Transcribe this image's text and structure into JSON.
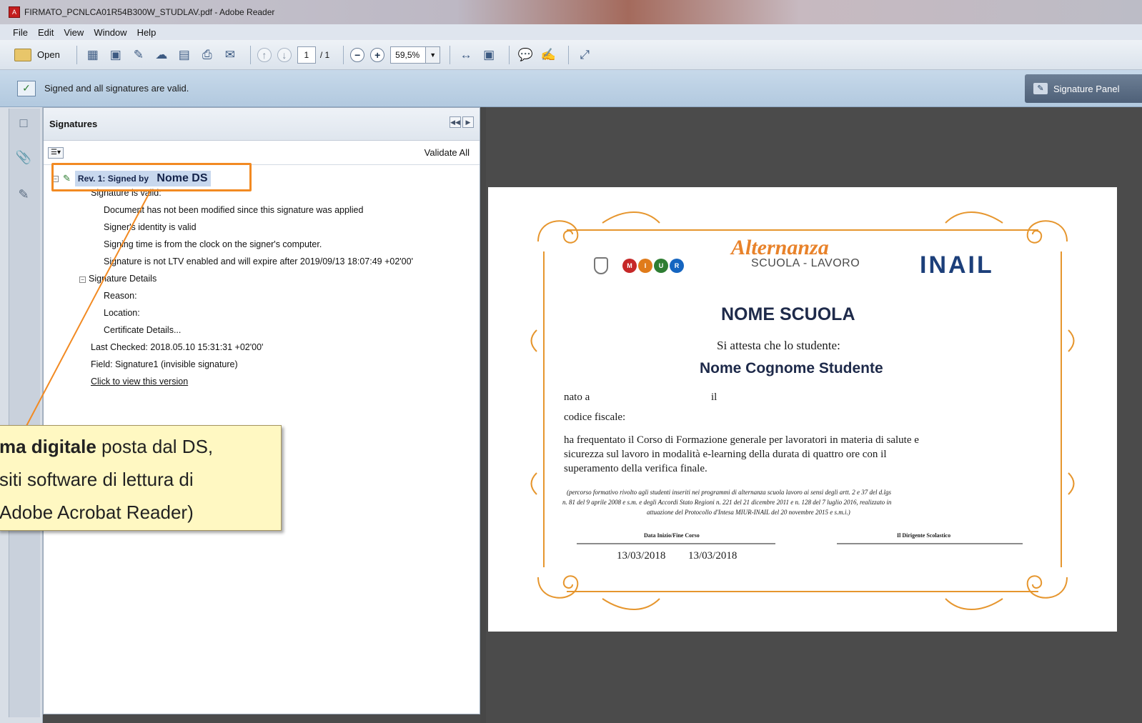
{
  "window": {
    "title": "FIRMATO_PCNLCA01R54B300W_STUDLAV.pdf - Adobe Reader"
  },
  "menu": [
    "File",
    "Edit",
    "View",
    "Window",
    "Help"
  ],
  "toolbar": {
    "open_label": "Open",
    "page_current": "1",
    "page_total": "/ 1",
    "zoom": "59,5%"
  },
  "sigbar": {
    "message": "Signed and all signatures are valid.",
    "panel_button": "Signature Panel"
  },
  "signatures_panel": {
    "title": "Signatures",
    "validate_all": "Validate All",
    "rev_label": "Rev. 1: Signed by",
    "rev_name": "Nome DS",
    "rows": [
      "Signature is valid:",
      "Document has not been modified since this signature was applied",
      "Signer's identity is valid",
      "Signing time is from the clock on the signer's computer.",
      "Signature is not LTV enabled and will expire after 2019/09/13 18:07:49 +02'00'",
      "Signature Details",
      "Reason:",
      "Location:",
      "Certificate Details...",
      "Last Checked: 2018.05.10 15:31:31 +02'00'",
      "Field: Signature1 (invisible signature)",
      "Click to view this version"
    ]
  },
  "callout": {
    "line1_bold": "ma digitale",
    "line1_rest": " posta dal DS,",
    "line2": "siti software di lettura di",
    "line3": "Adobe Acrobat Reader)"
  },
  "document": {
    "logo_title": "Alternanza",
    "logo_subtitle": "SCUOLA - LAVORO",
    "inail": "INAIL",
    "miur_letters": [
      "M",
      "I",
      "U",
      "R"
    ],
    "school": "NOME SCUOLA",
    "attesta": "Si attesta che lo studente:",
    "student": "Nome Cognome Studente",
    "nato_a": "nato a",
    "il": "il",
    "codice_fiscale": "codice fiscale:",
    "body_lines": [
      "ha frequentato il Corso di Formazione generale per lavoratori in materia di salute e",
      "sicurezza sul lavoro in modalità e-learning della durata di quattro ore con il",
      "superamento della verifica finale."
    ],
    "note_lines": [
      "(percorso formativo rivolto agli studenti inseriti nei programmi di alternanza scuola lavoro ai sensi degli artt. 2 e 37 del d.lgs",
      "n. 81 del 9 aprile 2008 e s.m. e degli Accordi Stato Regioni n. 221 del 21 dicembre 2011 e n. 128 del 7 luglio 2016, realizzato in",
      "attuazione del Protocollo d'Intesa MIUR-INAIL del 20 novembre 2015 e s.m.i.)"
    ],
    "data_label": "Data Inizio/Fine Corso",
    "dirigente_label": "Il Dirigente Scolastico",
    "date_start": "13/03/2018",
    "date_end": "13/03/2018"
  },
  "colors": {
    "highlight": "#f28a22",
    "callout_bg": "#fff8c2",
    "frame": "#e6962e",
    "school_text": "#1e2a4a"
  }
}
